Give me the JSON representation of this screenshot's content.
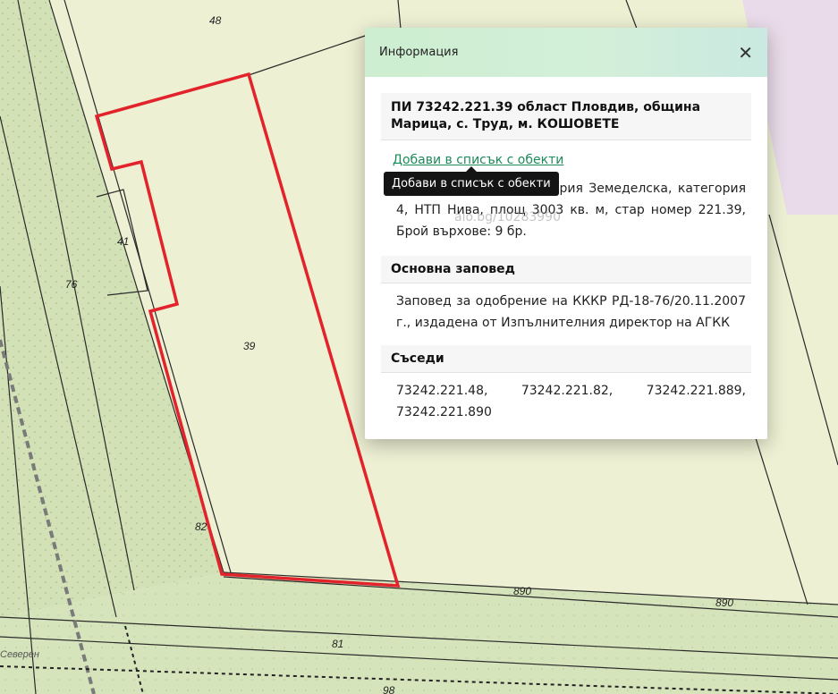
{
  "map": {
    "parcel_labels": {
      "p48": "48",
      "p41": "41",
      "p76": "76",
      "p39": "39",
      "p82": "82",
      "p890a": "890",
      "p890b": "890",
      "p81": "81",
      "p98": "98",
      "street": "Северен"
    },
    "colors": {
      "highlight": "#e3232b",
      "parcel_fill": "#eef0d4",
      "green_zone": "#d2e1b6",
      "pink_zone": "#e9dbe9"
    }
  },
  "info_panel": {
    "title": "Информация",
    "parcel_heading": "ПИ 73242.221.39 област Пловдив, община Марица, с. Труд, м. КОШОВЕТЕ",
    "add_link": "Добави в списък с обекти",
    "tooltip": "Добави в списък с обекти",
    "description": "ств. Частна, вид територия Земеделска, категория 4, НТП Нива, площ 3003 кв. м, стар номер 221.39, Брой върхове: 9 бр.",
    "watermark": "alo.bg/10283990",
    "order_heading": "Основна заповед",
    "order_text": "Заповед за одобрение на КККР РД-18-76/20.11.2007 г., издадена от Изпълнителния директор на АГКК",
    "neighbors_heading": "Съседи",
    "neighbors": [
      "73242.221.48,",
      "73242.221.82,",
      "73242.221.889,"
    ],
    "neighbors_last": "73242.221.890"
  }
}
